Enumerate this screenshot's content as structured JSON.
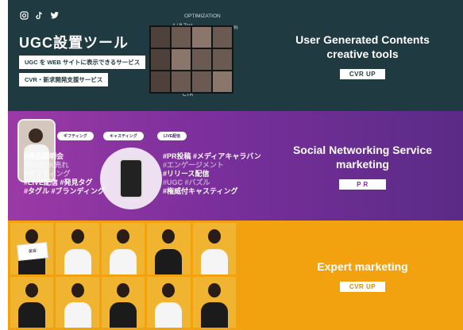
{
  "ugc": {
    "social_icons": [
      "instagram-icon",
      "tiktok-icon",
      "twitter-icon"
    ],
    "title": "UGC設置ツール",
    "tag1": "UGC を WEB サイトに表示できるサービス",
    "tag2": "CVR・新求開発支援サービス",
    "labels": {
      "optimization": "OPTIMIZATION",
      "ab": "A / B Test",
      "cvr": "CVR",
      "ctr": "CTR"
    },
    "headline": "User Generated Contents\ncreative tools",
    "button": "CVR UP"
  },
  "sns": {
    "chips": [
      "ギフティング",
      "キャスティング",
      "LIVE配信"
    ],
    "left_tags": [
      {
        "text": "#商品説明会",
        "dim": false
      },
      {
        "text": "#TIKTOK売れ",
        "dim": true
      },
      {
        "text": "#ギフティング",
        "dim": true
      },
      {
        "text": "#LIVE配信 #発見タグ",
        "dim": false
      },
      {
        "text": "#タグル #ブランディング",
        "dim": false
      }
    ],
    "right_tags": [
      {
        "text": "#PR投稿 #メディアキャラバン",
        "dim": false
      },
      {
        "text": "#エンゲージメント",
        "dim": true
      },
      {
        "text": "#リリース配信",
        "dim": false
      },
      {
        "text": "#UGC #バズル",
        "dim": true
      },
      {
        "text": "#権威付キャスティング",
        "dim": false
      }
    ],
    "headline": "Social Networking Service\nmarketing",
    "button": "P R"
  },
  "expert": {
    "cards": [
      "美容",
      "",
      "",
      "",
      "",
      "",
      "",
      "",
      "",
      ""
    ],
    "headline": "Expert marketing",
    "button": "CVR UP"
  },
  "colors": {
    "band1": "#1f3a41",
    "band2": "#7a2f9c",
    "band3": "#f2a20f"
  }
}
